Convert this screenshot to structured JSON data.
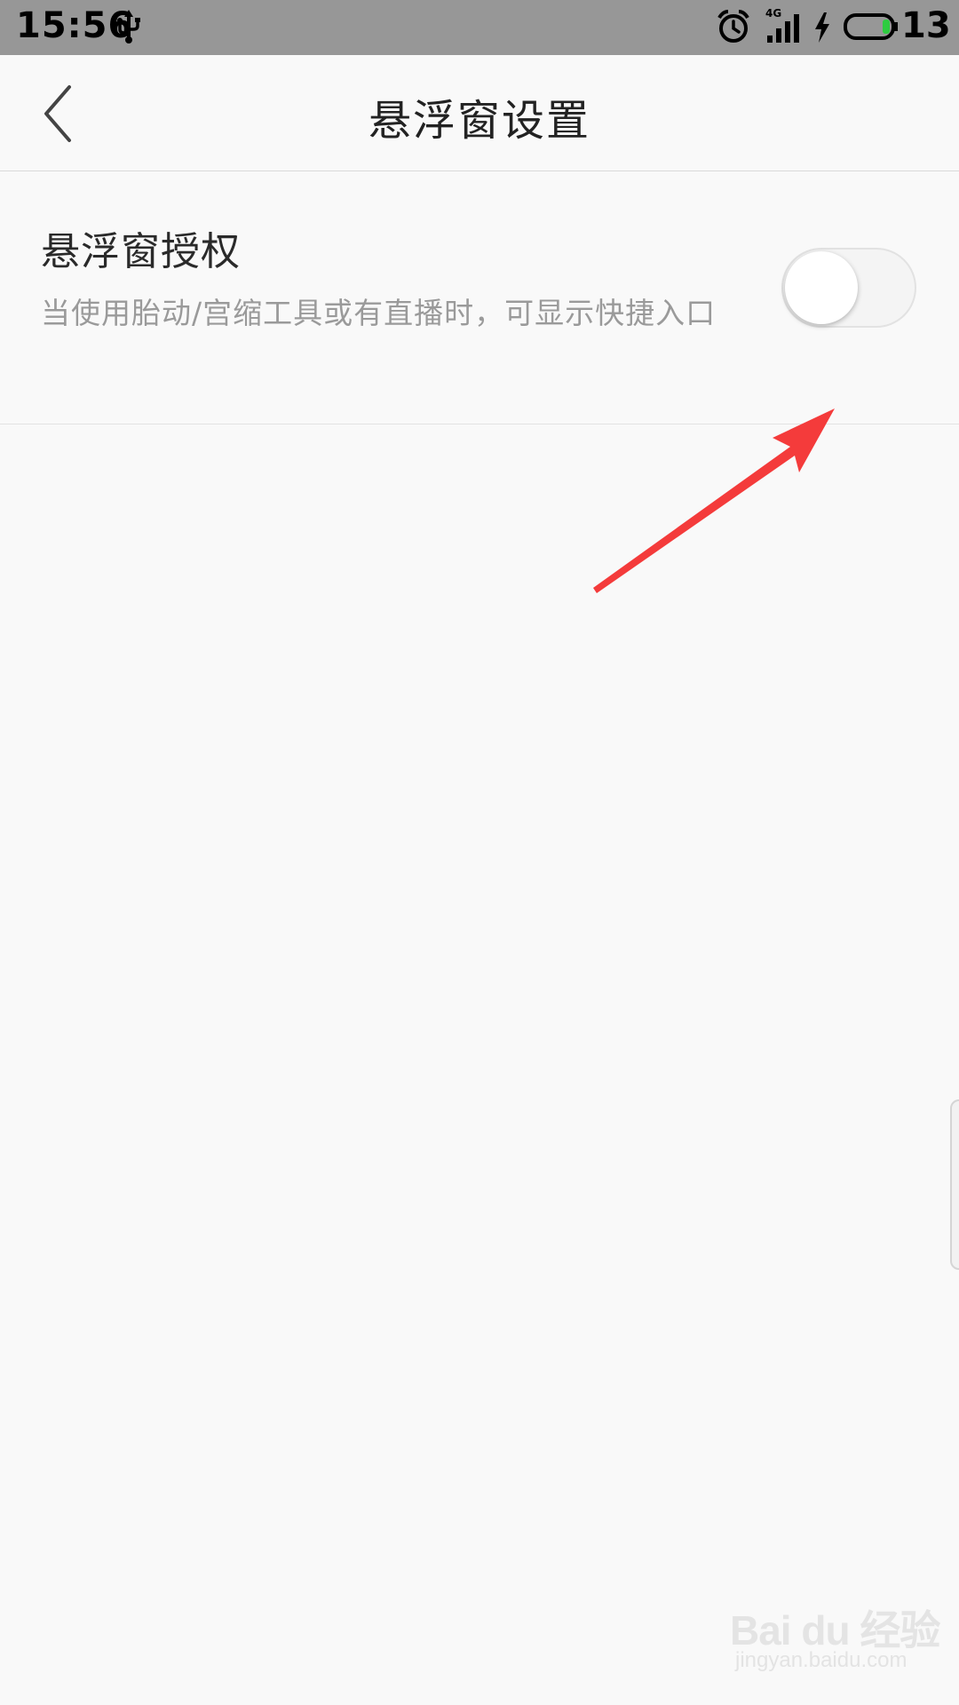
{
  "status_bar": {
    "time": "15:56",
    "network_label": "4G",
    "battery_level": "13",
    "icons": [
      "usb-icon",
      "alarm-icon",
      "signal-icon",
      "charging-icon",
      "battery-icon"
    ],
    "battery_color": "#2ecc40"
  },
  "header": {
    "title": "悬浮窗设置",
    "back_icon": "chevron-left-icon"
  },
  "setting": {
    "title": "悬浮窗授权",
    "description": "当使用胎动/宫缩工具或有直播时，可显示快捷入口",
    "toggle_state": "off"
  },
  "annotation": {
    "arrow_color": "#f43b3b"
  },
  "watermark": {
    "brand": "Bai du 经验",
    "url": "jingyan.baidu.com"
  }
}
